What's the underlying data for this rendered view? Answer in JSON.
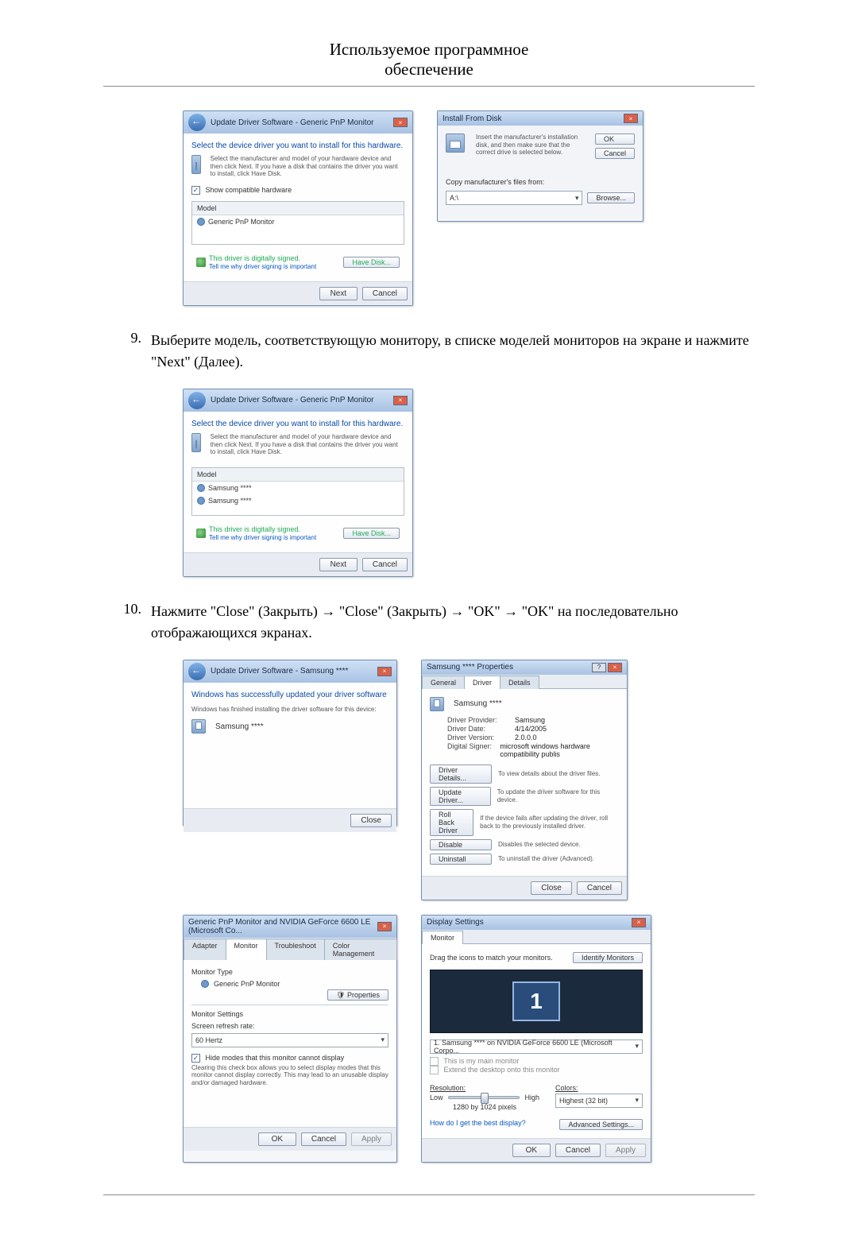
{
  "page": {
    "title_line1": "Используемое программное",
    "title_line2": "обеспечение"
  },
  "step9": {
    "num": "9.",
    "text": "Выберите модель, соответствующую монитору, в списке моделей мониторов на экране и нажмите \"Next\" (Далее)."
  },
  "step10": {
    "num": "10.",
    "text": "Нажмите \"Close\" (Закрыть) → \"Close\" (Закрыть) → \"OK\" → \"OK\" на последовательно отображающихся экранах."
  },
  "winA": {
    "title": "Update Driver Software - Generic PnP Monitor",
    "heading": "Select the device driver you want to install for this hardware.",
    "hint": "Select the manufacturer and model of your hardware device and then click Next. If you have a disk that contains the driver you want to install, click Have Disk.",
    "chk": "Show compatible hardware",
    "listhdr": "Model",
    "item": "Generic PnP Monitor",
    "signed": "This driver is digitally signed.",
    "tell": "Tell me why driver signing is important",
    "havedisk": "Have Disk...",
    "next": "Next",
    "cancel": "Cancel"
  },
  "winB": {
    "title": "Install From Disk",
    "msg": "Insert the manufacturer's installation disk, and then make sure that the correct drive is selected below.",
    "copy": "Copy manufacturer's files from:",
    "path": "A:\\",
    "ok": "OK",
    "cancel": "Cancel",
    "browse": "Browse..."
  },
  "winC": {
    "title": "Update Driver Software - Generic PnP Monitor",
    "heading": "Select the device driver you want to install for this hardware.",
    "hint": "Select the manufacturer and model of your hardware device and then click Next. If you have a disk that contains the driver you want to install, click Have Disk.",
    "listhdr": "Model",
    "item1": "Samsung ****",
    "item2": "Samsung ****",
    "signed": "This driver is digitally signed.",
    "tell": "Tell me why driver signing is important",
    "havedisk": "Have Disk...",
    "next": "Next",
    "cancel": "Cancel"
  },
  "winD": {
    "title": "Update Driver Software - Samsung ****",
    "heading": "Windows has successfully updated your driver software",
    "sub": "Windows has finished installing the driver software for this device:",
    "dev": "Samsung ****",
    "close": "Close"
  },
  "winE": {
    "title": "Samsung **** Properties",
    "tabs": {
      "general": "General",
      "driver": "Driver",
      "details": "Details"
    },
    "dev": "Samsung ****",
    "rows": {
      "provider_k": "Driver Provider:",
      "provider_v": "Samsung",
      "date_k": "Driver Date:",
      "date_v": "4/14/2005",
      "ver_k": "Driver Version:",
      "ver_v": "2.0.0.0",
      "signer_k": "Digital Signer:",
      "signer_v": "microsoft windows hardware compatibility publis"
    },
    "btns": {
      "details": "Driver Details...",
      "details_d": "To view details about the driver files.",
      "update": "Update Driver...",
      "update_d": "To update the driver software for this device.",
      "rollback": "Roll Back Driver",
      "rollback_d": "If the device fails after updating the driver, roll back to the previously installed driver.",
      "disable": "Disable",
      "disable_d": "Disables the selected device.",
      "uninstall": "Uninstall",
      "uninstall_d": "To uninstall the driver (Advanced)."
    },
    "close": "Close",
    "cancel": "Cancel"
  },
  "winF": {
    "title": "Generic PnP Monitor and NVIDIA GeForce 6600 LE (Microsoft Co...",
    "tabs": {
      "adapter": "Adapter",
      "monitor": "Monitor",
      "trouble": "Troubleshoot",
      "color": "Color Management"
    },
    "montype": "Monitor Type",
    "monname": "Generic PnP Monitor",
    "props": "Properties",
    "monset": "Monitor Settings",
    "refresh": "Screen refresh rate:",
    "hz": "60 Hertz",
    "hide": "Hide modes that this monitor cannot display",
    "hide_d": "Clearing this check box allows you to select display modes that this monitor cannot display correctly. This may lead to an unusable display and/or damaged hardware.",
    "ok": "OK",
    "cancel": "Cancel",
    "apply": "Apply"
  },
  "winG": {
    "title": "Display Settings",
    "tab": "Monitor",
    "drag": "Drag the icons to match your monitors.",
    "identify": "Identify Monitors",
    "mon_num": "1",
    "select": "1. Samsung **** on NVIDIA GeForce 6600 LE (Microsoft Corpo...",
    "chk1": "This is my main monitor",
    "chk2": "Extend the desktop onto this monitor",
    "res_lbl": "Resolution:",
    "col_lbl": "Colors:",
    "low": "Low",
    "high": "High",
    "res_val": "1280 by 1024 pixels",
    "colors": "Highest (32 bit)",
    "help": "How do I get the best display?",
    "adv": "Advanced Settings...",
    "ok": "OK",
    "cancel": "Cancel",
    "apply": "Apply"
  }
}
